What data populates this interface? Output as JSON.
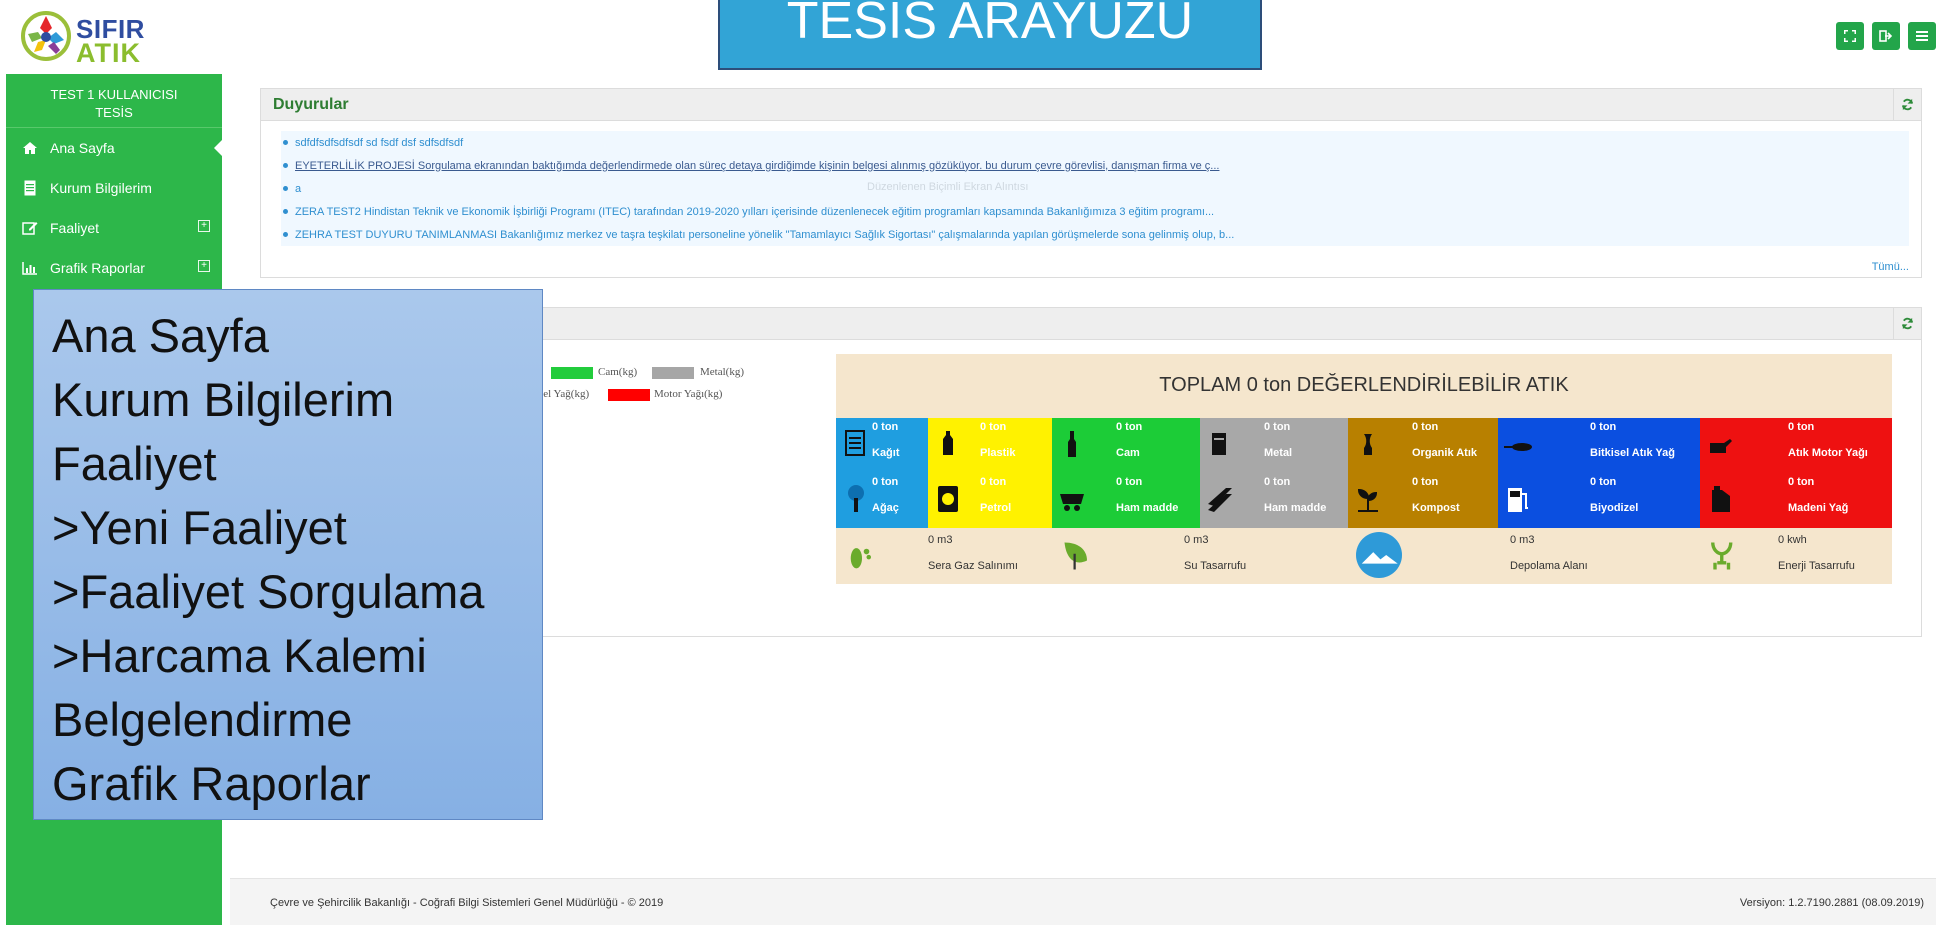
{
  "header": {
    "logo_line1": "SIFIR",
    "logo_line2": "ATIK",
    "title": "TESİS ARAYÜZÜ"
  },
  "header_buttons": [
    {
      "icon": "fullscreen-icon"
    },
    {
      "icon": "logout-icon"
    },
    {
      "icon": "menu-icon"
    }
  ],
  "sidebar": {
    "user_line1": "TEST 1 KULLANICISI",
    "user_line2": "TESİS",
    "items": [
      {
        "label": "Ana Sayfa",
        "icon": "home-icon",
        "expandable": false,
        "active": true
      },
      {
        "label": "Kurum Bilgilerim",
        "icon": "document-icon",
        "expandable": false,
        "active": false
      },
      {
        "label": "Faaliyet",
        "icon": "edit-icon",
        "expandable": true,
        "active": false
      },
      {
        "label": "Grafik Raporlar",
        "icon": "bar-chart-icon",
        "expandable": true,
        "active": false
      }
    ]
  },
  "announcements": {
    "title": "Duyurular",
    "items": [
      "sdfdfsdfsdfsdf sd fsdf dsf sdfsdfsdf",
      "EYETERLİLİK PROJESİ Sorgulama ekranından baktığımda değerlendirmede olan süreç detaya girdiğimde kişinin belgesi alınmış gözüküyor. bu durum çevre görevlisi, danışman firma ve ç...",
      "a",
      "ZERA TEST2 Hindistan Teknik ve Ekonomik İşbirliği Programı (ITEC) tarafından 2019-2020 yılları içerisinde düzenlenecek eğitim programları kapsamında Bakanlığımıza 3 eğitim programı...",
      "ZEHRA TEST DUYURU TANIMLANMASI Bakanlığımız merkez ve taşra teşkilatı personeline yönelik \"Tamamlayıcı Sağlık Sigortası\" çalışmalarında yapılan görüşmelerde sona gelinmiş olup, b..."
    ],
    "ghost_text": "Düzenlenen Biçimli Ekran Alıntısı",
    "more": "Tümü..."
  },
  "legend": {
    "items": [
      {
        "label": "Cam(kg)",
        "color": "#22cc3c"
      },
      {
        "label": "Metal(kg)",
        "color": "#a6a6a6"
      },
      {
        "label": "sel Yağ(kg)",
        "color": null
      },
      {
        "label": "Motor Yağı(kg)",
        "color": "#ff0000"
      }
    ]
  },
  "waste": {
    "title": "TOPLAM 0 ton DEĞERLENDİRİLEBİLİR ATIK",
    "row1": [
      {
        "name": "Kağıt",
        "amount": "0 ton",
        "color": "#1f9ee0",
        "icon": "paper-icon"
      },
      {
        "name": "Plastik",
        "amount": "0 ton",
        "color": "#fff200",
        "icon": "plastic-bottle-icon"
      },
      {
        "name": "Cam",
        "amount": "0 ton",
        "color": "#1ccc37",
        "icon": "glass-bottle-icon"
      },
      {
        "name": "Metal",
        "amount": "0 ton",
        "color": "#a8a8a8",
        "icon": "can-icon"
      },
      {
        "name": "Organik Atık",
        "amount": "0 ton",
        "color": "#b88000",
        "icon": "apple-core-icon"
      },
      {
        "name": "Bitkisel Atık Yağ",
        "amount": "0 ton",
        "color": "#0b4fe0",
        "icon": "frying-pan-icon"
      },
      {
        "name": "Atık Motor Yağı",
        "amount": "0 ton",
        "color": "#ee1111",
        "icon": "oil-can-icon"
      }
    ],
    "row2": [
      {
        "name": "Ağaç",
        "amount": "0 ton",
        "color": "#1f9ee0",
        "icon": "tree-icon"
      },
      {
        "name": "Petrol",
        "amount": "0 ton",
        "color": "#fff200",
        "icon": "barrel-icon"
      },
      {
        "name": "Ham madde",
        "amount": "0 ton",
        "color": "#1ccc37",
        "icon": "mine-cart-icon"
      },
      {
        "name": "Ham madde",
        "amount": "0 ton",
        "color": "#a8a8a8",
        "icon": "steel-beam-icon"
      },
      {
        "name": "Kompost",
        "amount": "0 ton",
        "color": "#b88000",
        "icon": "sprout-icon"
      },
      {
        "name": "Biyodizel",
        "amount": "0 ton",
        "color": "#0b4fe0",
        "icon": "fuel-pump-icon"
      },
      {
        "name": "Madeni Yağ",
        "amount": "0 ton",
        "color": "#ee1111",
        "icon": "jerrycan-icon"
      }
    ],
    "benefits": [
      {
        "name": "Sera Gaz Salınımı",
        "amount": "0 m3",
        "icon": "footprint-icon"
      },
      {
        "name": "Su Tasarrufu",
        "amount": "0 m3",
        "icon": "water-leaf-icon"
      },
      {
        "name": "Depolama Alanı",
        "amount": "0 m3",
        "icon": "landfill-icon"
      },
      {
        "name": "Enerji Tasarrufu",
        "amount": "0 kwh",
        "icon": "energy-plug-icon"
      }
    ]
  },
  "callout": {
    "lines": [
      "Ana Sayfa",
      "Kurum Bilgilerim",
      "Faaliyet",
      ">Yeni Faaliyet",
      ">Faaliyet Sorgulama",
      ">Harcama Kalemi",
      "Belgelendirme",
      "Grafik Raporlar"
    ]
  },
  "footer": {
    "left": "Çevre ve Şehircilik Bakanlığı - Coğrafi Bilgi Sistemleri Genel Müdürlüğü - © 2019",
    "right": "Versiyon: 1.2.7190.2881 (08.09.2019)"
  }
}
